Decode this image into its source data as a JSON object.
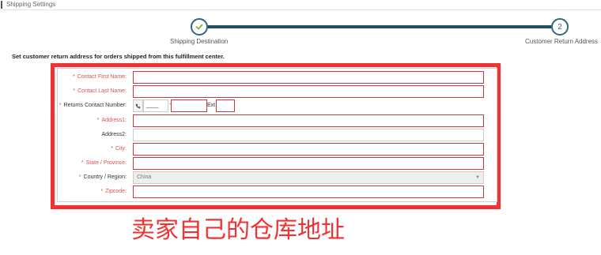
{
  "page": {
    "title": "Shipping Settings"
  },
  "stepper": {
    "steps": [
      {
        "label": "Shipping Destination",
        "state": "completed"
      },
      {
        "label": "Customer Return Address",
        "number": "2",
        "state": "current"
      }
    ],
    "accent_color": "#2d6a7f"
  },
  "intro_text": "Set customer return address for orders shipped from this fulfillment center.",
  "form": {
    "first_name": {
      "label": "Contact First Name:",
      "required": true,
      "value": ""
    },
    "last_name": {
      "label": "Contact Last Name:",
      "required": true,
      "value": ""
    },
    "phone": {
      "label": "Returns Contact Number:",
      "required": true,
      "icon": "phone-icon",
      "area_code": "____",
      "dash": "-",
      "number": "",
      "ext_label": "Ext",
      "ext": ""
    },
    "address1": {
      "label": "Address1:",
      "required": true,
      "value": ""
    },
    "address2": {
      "label": "Address2:",
      "required": false,
      "value": ""
    },
    "city": {
      "label": "City:",
      "required": true,
      "value": ""
    },
    "state": {
      "label": "State / Province:",
      "required": true,
      "value": ""
    },
    "country": {
      "label": "Country / Region:",
      "required": true,
      "value": "China",
      "arrow": "▼"
    },
    "zipcode": {
      "label": "Zipcode:",
      "required": true,
      "value": ""
    },
    "required_star": "*"
  },
  "annotation": {
    "caption": "卖家自己的仓库地址",
    "color": "#f03232"
  }
}
